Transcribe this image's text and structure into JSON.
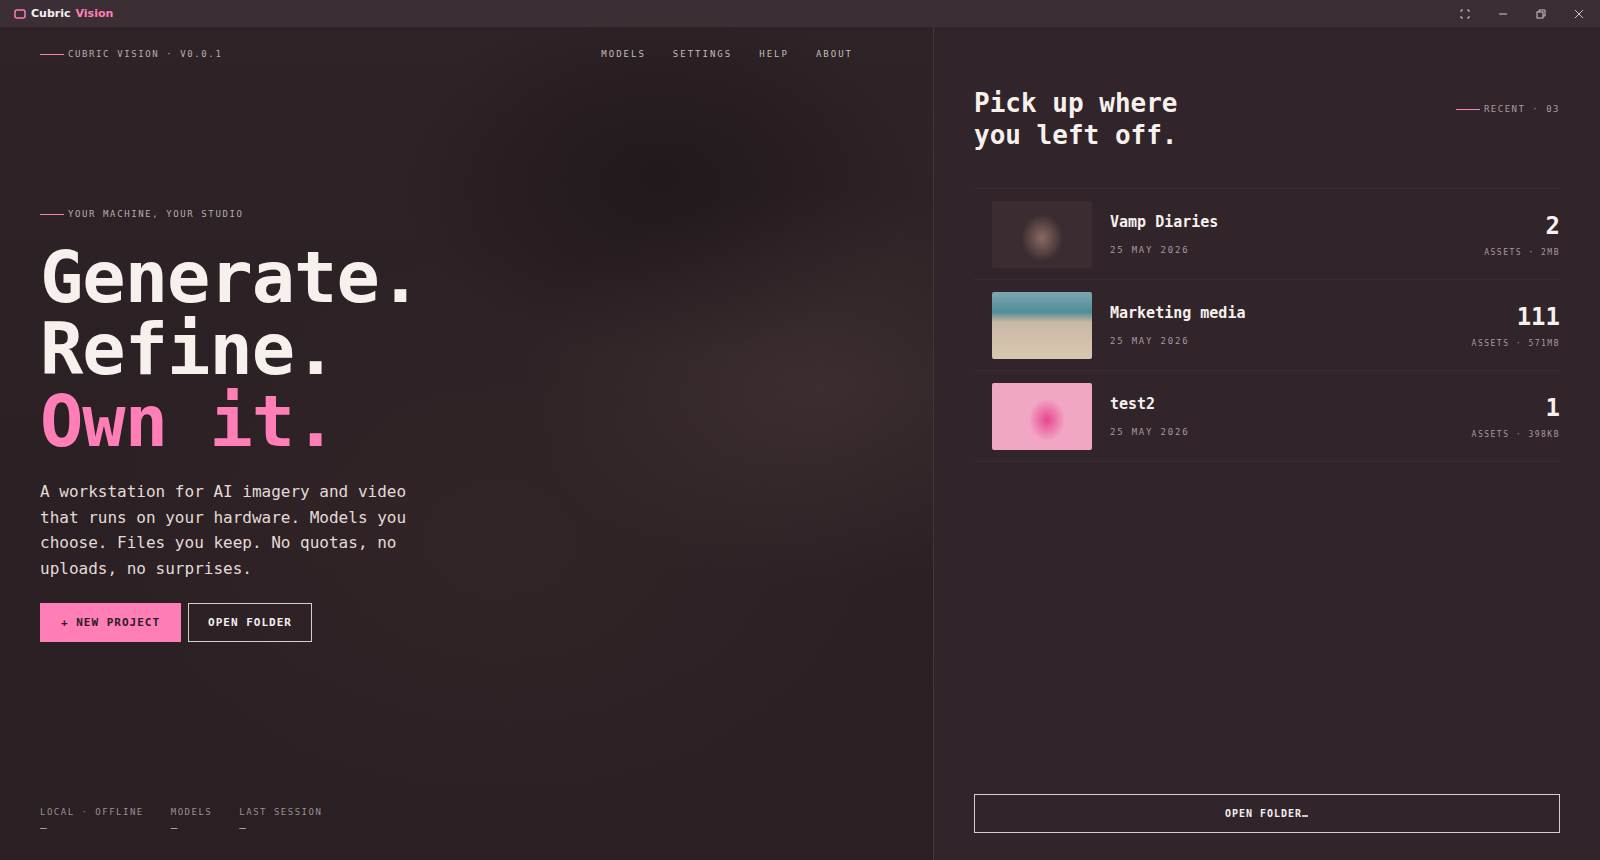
{
  "window": {
    "title_brand": "Cubric",
    "title_accent": "Vision"
  },
  "topbar": {
    "version": "CUBRIC VISION · V0.0.1",
    "nav": [
      "MODELS",
      "SETTINGS",
      "HELP",
      "ABOUT"
    ]
  },
  "hero": {
    "eyebrow": "YOUR MACHINE, YOUR STUDIO",
    "headline": [
      {
        "text": "Generate.",
        "accent": false
      },
      {
        "text": "Refine.",
        "accent": false
      },
      {
        "text": "Own it.",
        "accent": true
      }
    ],
    "body": "A workstation for AI imagery and video that runs on your hardware. Models you choose. Files you keep. No quotas, no uploads, no surprises.",
    "buttons": [
      {
        "label": "+ NEW PROJECT",
        "primary": true
      },
      {
        "label": "OPEN FOLDER",
        "primary": false
      }
    ]
  },
  "stats": [
    {
      "label": "LOCAL · OFFLINE",
      "value": "—"
    },
    {
      "label": "MODELS",
      "value": "—"
    },
    {
      "label": "LAST SESSION",
      "value": "—"
    }
  ],
  "recent": {
    "heading": [
      "Pick up where",
      "you left off."
    ],
    "tag": "RECENT · 03",
    "projects": [
      {
        "name": "Vamp Diaries",
        "date": "25 MAY 2026",
        "count": "2",
        "meta": "ASSETS · 2MB"
      },
      {
        "name": "Marketing media",
        "date": "25 MAY 2026",
        "count": "111",
        "meta": "ASSETS · 571MB"
      },
      {
        "name": "test2",
        "date": "25 MAY 2026",
        "count": "1",
        "meta": "ASSETS · 398KB"
      }
    ],
    "open_button": "OPEN FOLDER…"
  }
}
